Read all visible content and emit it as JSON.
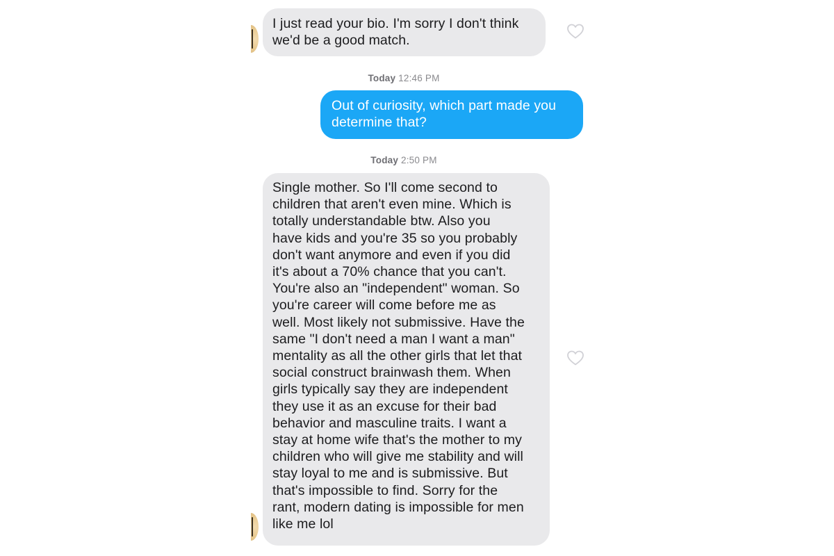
{
  "conversation": {
    "messages": [
      {
        "direction": "received",
        "text": "I just read your bio. I'm sorry I don't think\nwe'd be a good match."
      },
      {
        "direction": "sent",
        "text": "Out of curiosity, which part made you\ndetermine that?"
      },
      {
        "direction": "received",
        "text": "Single mother. So I'll come second to\nchildren that aren't even mine. Which is\ntotally understandable btw. Also you\nhave kids and you're 35 so you probably\ndon't want anymore and even if you did\nit's about a 70% chance that you can't.\nYou're also an \"independent\" woman. So\nyou're career will come before me as\nwell. Most likely not submissive. Have the\nsame \"I don't need a man I want a man\"\nmentality as all the other girls that let that\nsocial construct brainwash them. When\ngirls typically say they are independent\nthey use it as an excuse for their bad\nbehavior and masculine traits. I want a\nstay at home wife that's the mother to my\nchildren who will give me stability and will\nstay loyal to me and is submissive. But\nthat's impossible to find. Sorry for the\nrant, modern dating is impossible for men\nlike me lol"
      }
    ],
    "timestamps": [
      {
        "day": "Today",
        "time": "12:46 PM"
      },
      {
        "day": "Today",
        "time": "2:50 PM"
      }
    ]
  },
  "icons": {
    "like": "heart-outline-icon",
    "avatar": "contact-avatar"
  },
  "colors": {
    "sent_bubble": "#1ba7f6",
    "received_bubble": "#e9e9eb",
    "timestamp": "#8a8a8e"
  }
}
